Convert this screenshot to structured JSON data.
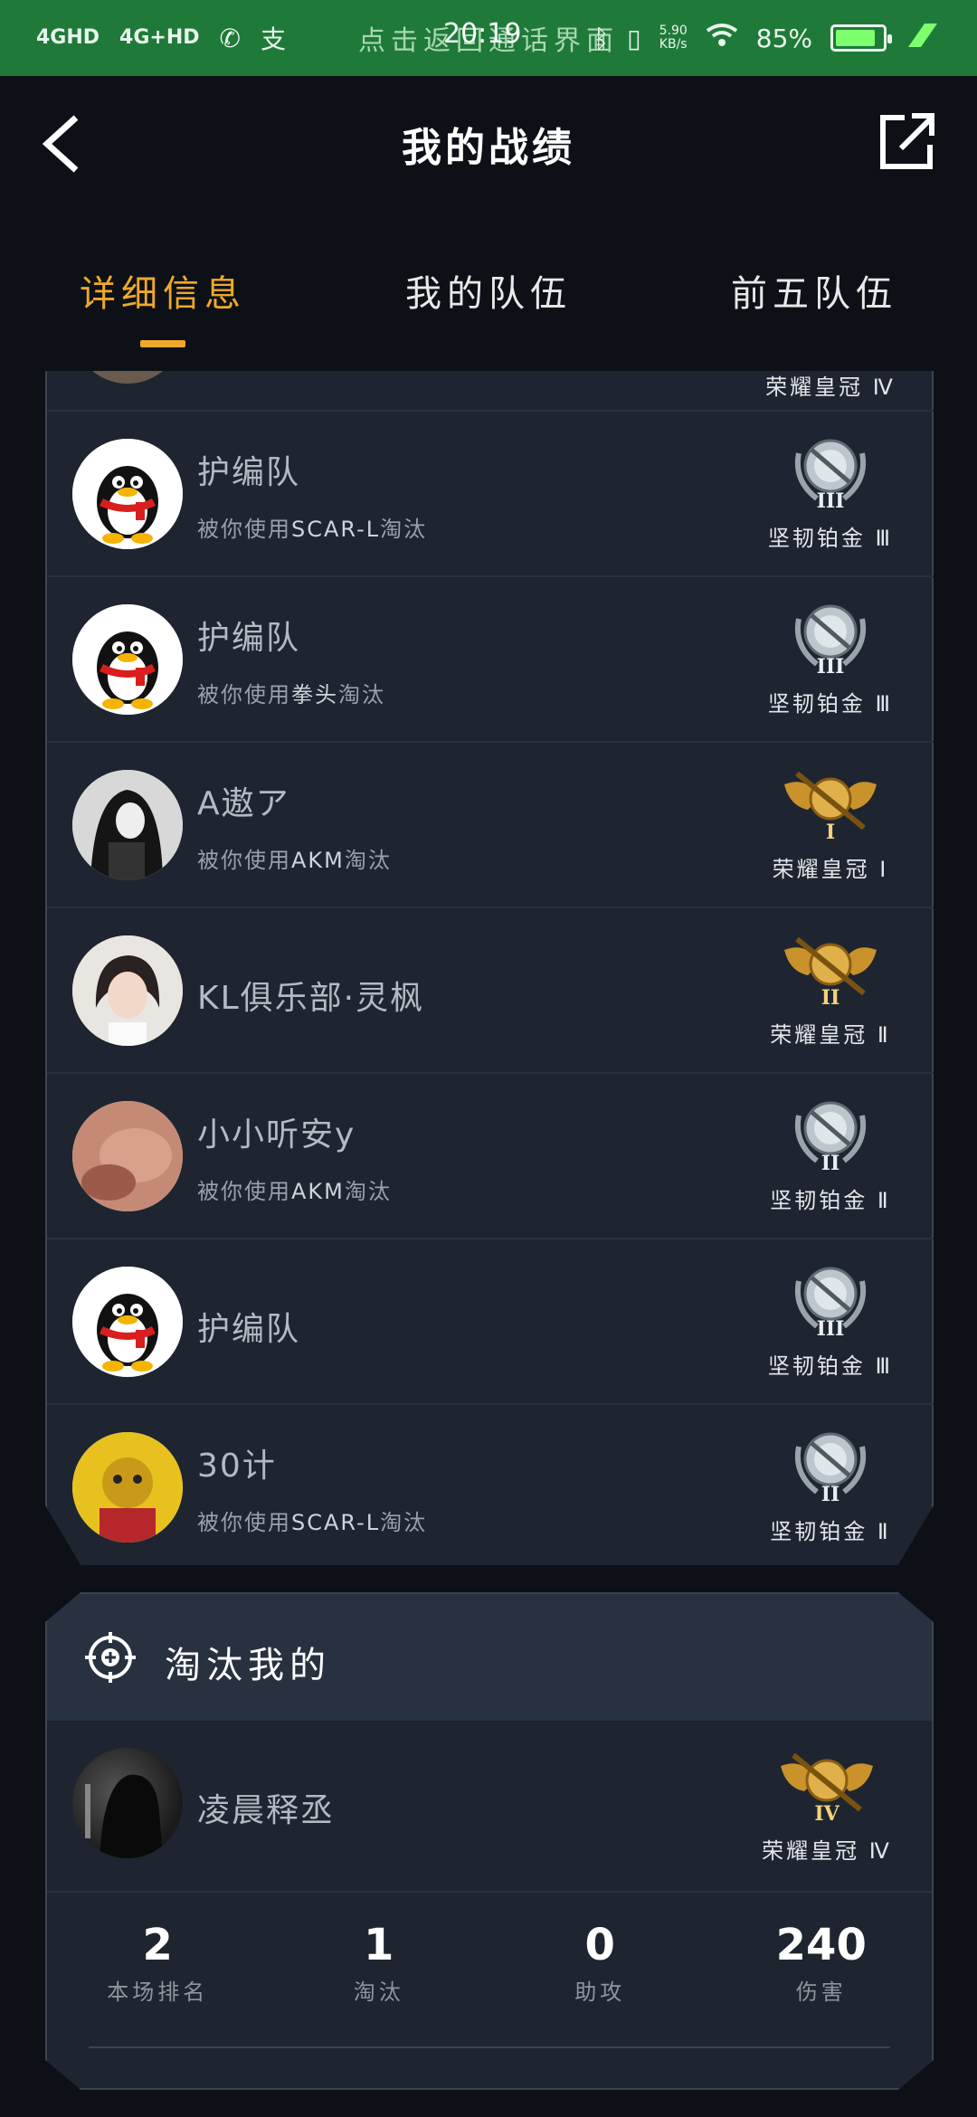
{
  "status_bar": {
    "network1": "4GHD",
    "network2": "4G+HD",
    "hint": "点击返回通话界面",
    "time": "20:19",
    "speed_value": "5.90",
    "speed_unit": "KB/s",
    "battery": "85%"
  },
  "header": {
    "title": "我的战绩"
  },
  "tabs": [
    {
      "label": "详细信息",
      "active": true
    },
    {
      "label": "我的队伍",
      "active": false
    },
    {
      "label": "前五队伍",
      "active": false
    }
  ],
  "partial_row": {
    "rank": "荣耀皇冠 Ⅳ"
  },
  "rows": [
    {
      "name": "护编队",
      "subtitle_prefix": "被你使用",
      "weapon": "SCAR-L",
      "subtitle_suffix": "淘汰",
      "avatar": "penguin",
      "rank": "坚韧铂金 Ⅲ",
      "tier": "platinum",
      "tier_numeral": "III"
    },
    {
      "name": "护编队",
      "subtitle_prefix": "被你使用",
      "weapon": "拳头",
      "subtitle_suffix": "淘汰",
      "avatar": "penguin",
      "rank": "坚韧铂金 Ⅲ",
      "tier": "platinum",
      "tier_numeral": "III"
    },
    {
      "name": "A遨ア",
      "subtitle_prefix": "被你使用",
      "weapon": "AKM",
      "subtitle_suffix": "淘汰",
      "avatar": "hooded",
      "rank": "荣耀皇冠 Ⅰ",
      "tier": "crown",
      "tier_numeral": "I"
    },
    {
      "name": "KL俱乐部·灵枫",
      "subtitle_prefix": "",
      "weapon": "",
      "subtitle_suffix": "",
      "avatar": "girl",
      "rank": "荣耀皇冠 Ⅱ",
      "tier": "crown",
      "tier_numeral": "II"
    },
    {
      "name": "小小听安y",
      "subtitle_prefix": "被你使用",
      "weapon": "AKM",
      "subtitle_suffix": "淘汰",
      "avatar": "skin",
      "rank": "坚韧铂金 Ⅱ",
      "tier": "platinum",
      "tier_numeral": "II"
    },
    {
      "name": "护编队",
      "subtitle_prefix": "",
      "weapon": "",
      "subtitle_suffix": "",
      "avatar": "penguin",
      "rank": "坚韧铂金 Ⅲ",
      "tier": "platinum",
      "tier_numeral": "III"
    },
    {
      "name": "30计",
      "subtitle_prefix": "被你使用",
      "weapon": "SCAR-L",
      "subtitle_suffix": "淘汰",
      "avatar": "gold",
      "rank": "坚韧铂金 Ⅱ",
      "tier": "platinum",
      "tier_numeral": "II"
    }
  ],
  "killer": {
    "title": "淘汰我的",
    "name": "凌晨释丞",
    "rank": "荣耀皇冠 Ⅳ",
    "tier_numeral": "IV"
  },
  "stats": [
    {
      "value": "2",
      "label": "本场排名"
    },
    {
      "value": "1",
      "label": "淘汰"
    },
    {
      "value": "0",
      "label": "助攻"
    },
    {
      "value": "240",
      "label": "伤害"
    }
  ],
  "colors": {
    "accent": "#f0a92a",
    "status_bar": "#1f7a3a",
    "panel": "#1e2530",
    "background": "#0d1117"
  }
}
